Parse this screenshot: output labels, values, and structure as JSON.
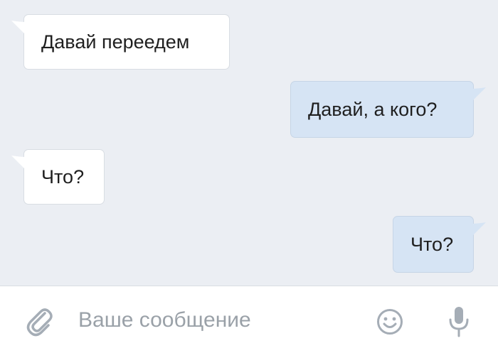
{
  "messages": [
    {
      "direction": "incoming",
      "text": "Давай переедем"
    },
    {
      "direction": "outgoing",
      "text": "Давай, а кого?"
    },
    {
      "direction": "incoming",
      "text": "Что?"
    },
    {
      "direction": "outgoing",
      "text": "Что?"
    }
  ],
  "composer": {
    "placeholder": "Ваше сообщение",
    "value": "",
    "attach_icon": "paperclip-icon",
    "emoji_icon": "smiley-icon",
    "mic_icon": "microphone-icon"
  },
  "colors": {
    "background": "#ebeef3",
    "incoming_bubble": "#ffffff",
    "outgoing_bubble": "#d6e4f4",
    "icon": "#a5adb6",
    "placeholder": "#9aa1a8"
  }
}
